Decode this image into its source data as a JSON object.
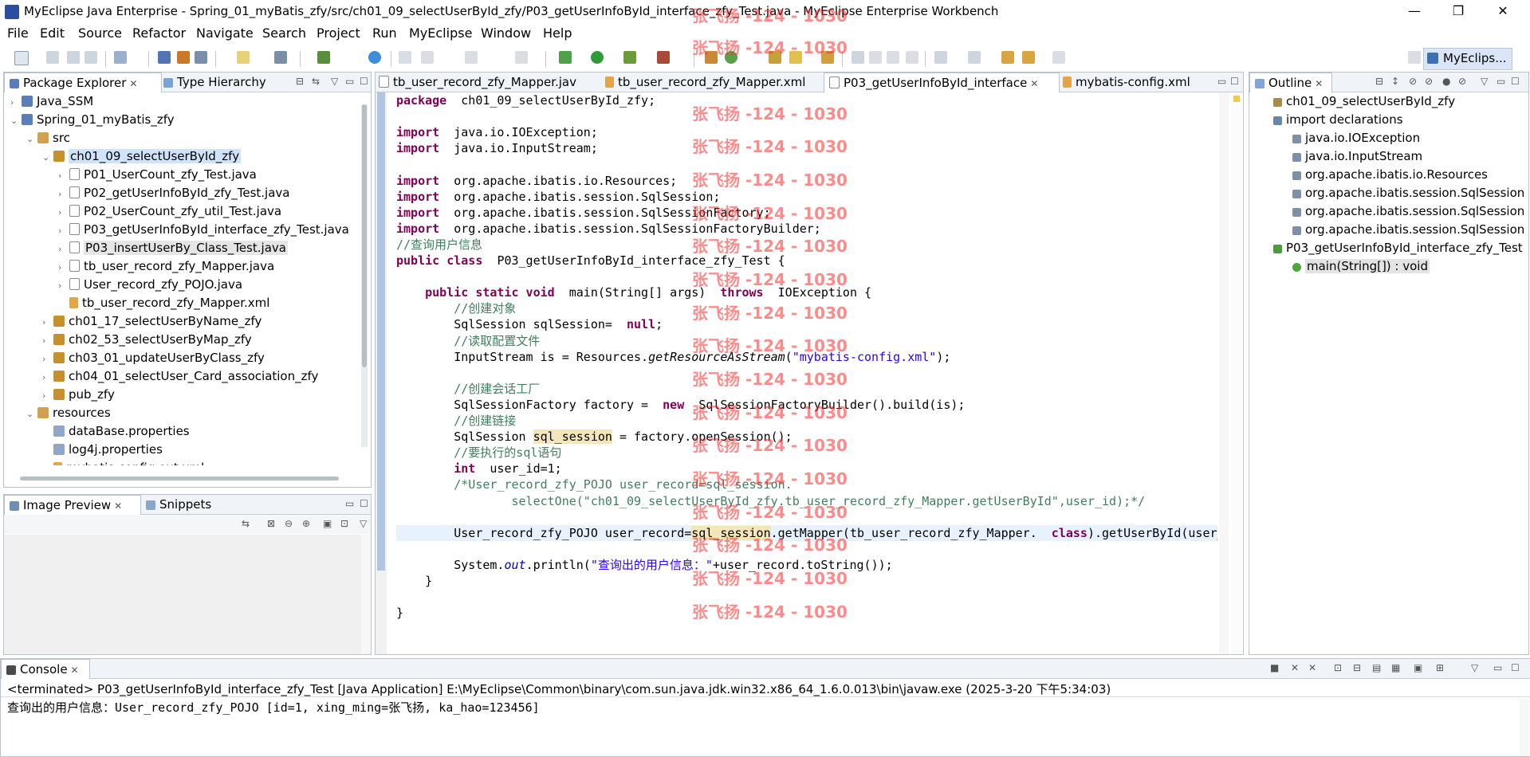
{
  "window": {
    "title": "MyEclipse Java Enterprise - Spring_01_myBatis_zfy/src/ch01_09_selectUserById_zfy/P03_getUserInfoById_interface_zfy_Test.java - MyEclipse Enterprise Workbench",
    "minimize": "—",
    "maximize": "❐",
    "close": "✕"
  },
  "menu": [
    "File",
    "Edit",
    "Source",
    "Refactor",
    "Navigate",
    "Search",
    "Project",
    "Run",
    "MyEclipse",
    "Window",
    "Help"
  ],
  "perspective": "MyEclips...",
  "package_explorer": {
    "tab_label": "Package Explorer",
    "tab2_label": "Type Hierarchy",
    "items": [
      {
        "label": "Java_SSM",
        "level": 0,
        "icon": "project-icon",
        "arrow": "›"
      },
      {
        "label": "Spring_01_myBatis_zfy",
        "level": 0,
        "icon": "project-icon",
        "arrow": "⌄"
      },
      {
        "label": "src",
        "level": 1,
        "icon": "source-folder-icon",
        "arrow": "⌄"
      },
      {
        "label": "ch01_09_selectUserById_zfy",
        "level": 2,
        "icon": "package-icon",
        "arrow": "⌄",
        "selected": true
      },
      {
        "label": "P01_UserCount_zfy_Test.java",
        "level": 3,
        "icon": "java-file-icon",
        "arrow": "›"
      },
      {
        "label": "P02_getUserInfoById_zfy_Test.java",
        "level": 3,
        "icon": "java-file-icon",
        "arrow": "›"
      },
      {
        "label": "P02_UserCount_zfy_util_Test.java",
        "level": 3,
        "icon": "java-file-icon",
        "arrow": "›"
      },
      {
        "label": "P03_getUserInfoById_interface_zfy_Test.java",
        "level": 3,
        "icon": "java-file-icon",
        "arrow": "›"
      },
      {
        "label": "P03_insertUserBy_Class_Test.java",
        "level": 3,
        "icon": "java-file-icon",
        "arrow": "›",
        "hover": true
      },
      {
        "label": "tb_user_record_zfy_Mapper.java",
        "level": 3,
        "icon": "java-file-icon",
        "arrow": "›"
      },
      {
        "label": "User_record_zfy_POJO.java",
        "level": 3,
        "icon": "java-file-icon",
        "arrow": "›"
      },
      {
        "label": "tb_user_record_zfy_Mapper.xml",
        "level": 3,
        "icon": "xml-file-icon",
        "arrow": ""
      },
      {
        "label": "ch01_17_selectUserByName_zfy",
        "level": 2,
        "icon": "package-icon",
        "arrow": "›"
      },
      {
        "label": "ch02_53_selectUserByMap_zfy",
        "level": 2,
        "icon": "package-icon",
        "arrow": "›"
      },
      {
        "label": "ch03_01_updateUserByClass_zfy",
        "level": 2,
        "icon": "package-icon",
        "arrow": "›"
      },
      {
        "label": "ch04_01_selectUser_Card_association_zfy",
        "level": 2,
        "icon": "package-icon",
        "arrow": "›"
      },
      {
        "label": "pub_zfy",
        "level": 2,
        "icon": "package-icon",
        "arrow": "›"
      },
      {
        "label": "resources",
        "level": 1,
        "icon": "source-folder-icon",
        "arrow": "⌄"
      },
      {
        "label": "dataBase.properties",
        "level": 2,
        "icon": "properties-file-icon",
        "arrow": ""
      },
      {
        "label": "log4j.properties",
        "level": 2,
        "icon": "properties-file-icon",
        "arrow": ""
      },
      {
        "label": "mybatis-config.out.xml",
        "level": 2,
        "icon": "xml-file-icon",
        "arrow": ""
      }
    ]
  },
  "image_preview": {
    "tab_label": "Image Preview",
    "tab2_label": "Snippets"
  },
  "editor": {
    "tabs": [
      {
        "label": "tb_user_record_zfy_Mapper.jav",
        "active": false
      },
      {
        "label": "tb_user_record_zfy_Mapper.xml",
        "active": false
      },
      {
        "label": "P03_getUserInfoById_interface",
        "active": true
      },
      {
        "label": "mybatis-config.xml",
        "active": false
      }
    ],
    "lines": [
      [
        [
          "kw",
          "package"
        ],
        [
          "",
          "ch01_09_selectUserById_zfy;"
        ]
      ],
      [],
      [
        [
          "kw",
          "import"
        ],
        [
          "",
          "java.io.IOException;"
        ]
      ],
      [
        [
          "kw",
          "import"
        ],
        [
          "",
          "java.io.InputStream;"
        ]
      ],
      [],
      [
        [
          "kw",
          "import"
        ],
        [
          "",
          "org.apache.ibatis.io.Resources;"
        ]
      ],
      [
        [
          "kw",
          "import"
        ],
        [
          "",
          "org.apache.ibatis.session.SqlSession;"
        ]
      ],
      [
        [
          "kw",
          "import"
        ],
        [
          "",
          "org.apache.ibatis.session.SqlSessionFactory;"
        ]
      ],
      [
        [
          "kw",
          "import"
        ],
        [
          "",
          "org.apache.ibatis.session.SqlSessionFactoryBuilder;"
        ]
      ],
      [
        [
          "cm",
          "//查询用户信息"
        ]
      ],
      [
        [
          "kw",
          "public class"
        ],
        [
          "",
          "P03_getUserInfoById_interface_zfy_Test {"
        ]
      ],
      [],
      [
        [
          "",
          "    "
        ],
        [
          "kw",
          "public static void"
        ],
        [
          "",
          "main(String[] args)"
        ],
        [
          "kw",
          "throws"
        ],
        [
          "",
          "IOException {"
        ]
      ],
      [
        [
          "cm",
          "        //创建对象"
        ]
      ],
      [
        [
          "",
          "        SqlSession sqlSession="
        ],
        [
          "kw",
          "null"
        ],
        [
          "",
          ";"
        ]
      ],
      [
        [
          "cm",
          "        //读取配置文件"
        ]
      ],
      [
        [
          "",
          "        InputStream is = Resources."
        ],
        [
          "it",
          "getResourceAsStream"
        ],
        [
          "",
          "("
        ],
        [
          "st",
          "\"mybatis-config.xml\""
        ],
        [
          "",
          ");"
        ]
      ],
      [],
      [
        [
          "cm",
          "        //创建会话工厂"
        ]
      ],
      [
        [
          "",
          "        SqlSessionFactory factory ="
        ],
        [
          "kw",
          "new"
        ],
        [
          "",
          "  SqlSessionFactoryBuilder().build(is);"
        ]
      ],
      [
        [
          "cm",
          "        //创建链接"
        ]
      ],
      [
        [
          "",
          "        SqlSession "
        ],
        [
          "hl",
          "sql_session"
        ],
        [
          "",
          " = factory.openSession();"
        ]
      ],
      [
        [
          "cm",
          "        //要执行的sql语句"
        ]
      ],
      [
        [
          "",
          "        "
        ],
        [
          "kw",
          "int"
        ],
        [
          "",
          "user_id=1;"
        ]
      ],
      [
        [
          "cm",
          "        /*User_record_zfy_POJO user_record=sql_session."
        ]
      ],
      [
        [
          "cm",
          "                selectOne(\"ch01_09_selectUserById_zfy.tb_user_record_zfy_Mapper.getUserById\",user_id);*/"
        ]
      ],
      [],
      [
        [
          "",
          "        User_record_zfy_POJO user_record="
        ],
        [
          "hl",
          "sql_session"
        ],
        [
          "",
          ".getMapper(tb_user_record_zfy_Mapper."
        ],
        [
          "kw",
          "class"
        ],
        [
          "",
          ").getUserById(user_id"
        ]
      ],
      [],
      [
        [
          "",
          "        System."
        ],
        [
          "fl",
          "out"
        ],
        [
          "",
          ".println("
        ],
        [
          "st",
          "\"查询出的用户信息：\""
        ],
        [
          "",
          "+user_record.toString());"
        ]
      ],
      [
        [
          "",
          "    }"
        ]
      ],
      [],
      [
        [
          "",
          "}"
        ]
      ]
    ]
  },
  "outline": {
    "tab_label": "Outline",
    "items": [
      {
        "label": "ch01_09_selectUserById_zfy",
        "level": 0,
        "icon": "package-decl-icon"
      },
      {
        "label": "import declarations",
        "level": 0,
        "icon": "imports-icon"
      },
      {
        "label": "java.io.IOException",
        "level": 1,
        "icon": "import-icon"
      },
      {
        "label": "java.io.InputStream",
        "level": 1,
        "icon": "import-icon"
      },
      {
        "label": "org.apache.ibatis.io.Resources",
        "level": 1,
        "icon": "import-icon"
      },
      {
        "label": "org.apache.ibatis.session.SqlSession",
        "level": 1,
        "icon": "import-icon"
      },
      {
        "label": "org.apache.ibatis.session.SqlSession",
        "level": 1,
        "icon": "import-icon"
      },
      {
        "label": "org.apache.ibatis.session.SqlSession",
        "level": 1,
        "icon": "import-icon"
      },
      {
        "label": "P03_getUserInfoById_interface_zfy_Test",
        "level": 0,
        "icon": "class-icon"
      },
      {
        "label": "main(String[]) : void",
        "level": 1,
        "icon": "method-icon",
        "selected": true
      }
    ]
  },
  "console": {
    "tab_label": "Console",
    "status": "<terminated> P03_getUserInfoById_interface_zfy_Test [Java Application] E:\\MyEclipse\\Common\\binary\\com.sun.java.jdk.win32.x86_64_1.6.0.013\\bin\\javaw.exe (2025-3-20 下午5:34:03)",
    "output": "查询出的用户信息：User_record_zfy_POJO [id=1, xing_ming=张飞扬, ka_hao=123456]"
  },
  "watermark": "张飞扬 -124 - 1030",
  "colors": {
    "keyword": "#7f0055",
    "comment": "#3f7f5f",
    "string": "#2a00ff",
    "selection": "#cfe3fa",
    "watermark": "#ff2b2b"
  }
}
